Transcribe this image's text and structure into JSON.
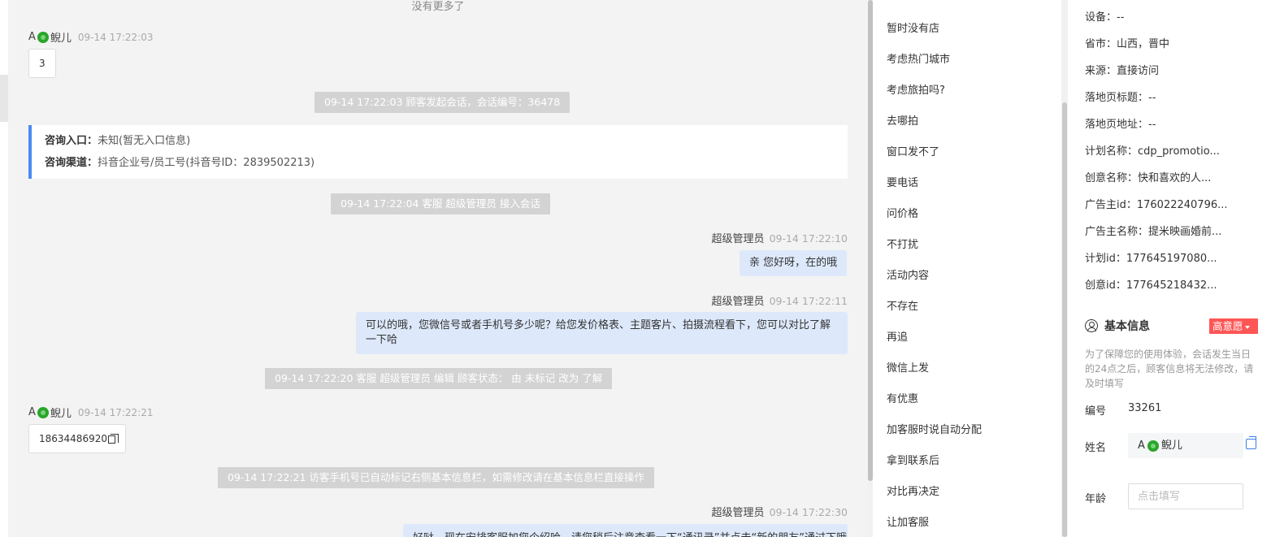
{
  "chat": {
    "no_more": "没有更多了",
    "visitor": {
      "prefix": "A",
      "name": "鲵儿"
    },
    "msg1": {
      "time": "09-14 17:22:03",
      "text": "3"
    },
    "sys1": "09-14 17:22:03 顾客发起会话，会话编号：36478",
    "info_card": {
      "entry_label": "咨询入口：",
      "entry_value": "未知(暂无入口信息)",
      "channel_label": "咨询渠道：",
      "channel_value": "抖音企业号/员工号(抖音号ID：2839502213)"
    },
    "sys2": "09-14 17:22:04 客服 超级管理员 接入会话",
    "agent_name": "超级管理员",
    "agent_msg1": {
      "time": "09-14 17:22:10",
      "text": "亲 您好呀，在的哦"
    },
    "agent_msg2": {
      "time": "09-14 17:22:11",
      "line1": "可以的哦，您微信号或者手机号多少呢？给您发价格表、主题客片、拍摄流程看下，您可以对比了解",
      "line2": "一下哈"
    },
    "sys3": "09-14 17:22:20 客服 超级管理员 编辑 顾客状态： 由 未标记 改为 了解",
    "msg2": {
      "time": "09-14 17:22:21",
      "text": "18634486920"
    },
    "sys4": "09-14 17:22:21 访客手机号已自动标记右侧基本信息栏，如需修改请在基本信息栏直接操作",
    "agent_msg3": {
      "time": "09-14 17:22:30",
      "text": "好哒，现在安排客服加您个绍哈，请您稍后注意查看一下“通讯录”并点击“新的朋友”通过下哦"
    }
  },
  "phrases": [
    "暂时没有店",
    "考虑热门城市",
    "考虑旅拍吗?",
    "去哪拍",
    "窗口发不了",
    "要电话",
    "问价格",
    "不打扰",
    "活动内容",
    "不存在",
    "再追",
    "微信上发",
    "有优惠",
    "加客服时说自动分配",
    "拿到联系后",
    "对比再决定",
    "让加客服"
  ],
  "info": {
    "attrs": [
      "设备：--",
      "省市：山西，晋中",
      "来源：直接访问",
      "落地页标题：--",
      "落地页地址：--",
      "计划名称：cdp_promotio...",
      "创意名称：快和喜欢的人...",
      "广告主id：176022240796...",
      "广告主名称：提米映画婚前...",
      "计划id：177645197080...",
      "创意id：177645218432..."
    ],
    "section_title": "基本信息",
    "intent_badge": "高意愿",
    "notice": "为了保障您的使用体验，会话发生当日的24点之后，顾客信息将无法修改，请及时填写",
    "id_label": "编号",
    "id_value": "33261",
    "name_label": "姓名",
    "name_prefix": "A",
    "name_value": "鲵儿",
    "age_label": "年龄",
    "age_placeholder": "点击填写"
  }
}
